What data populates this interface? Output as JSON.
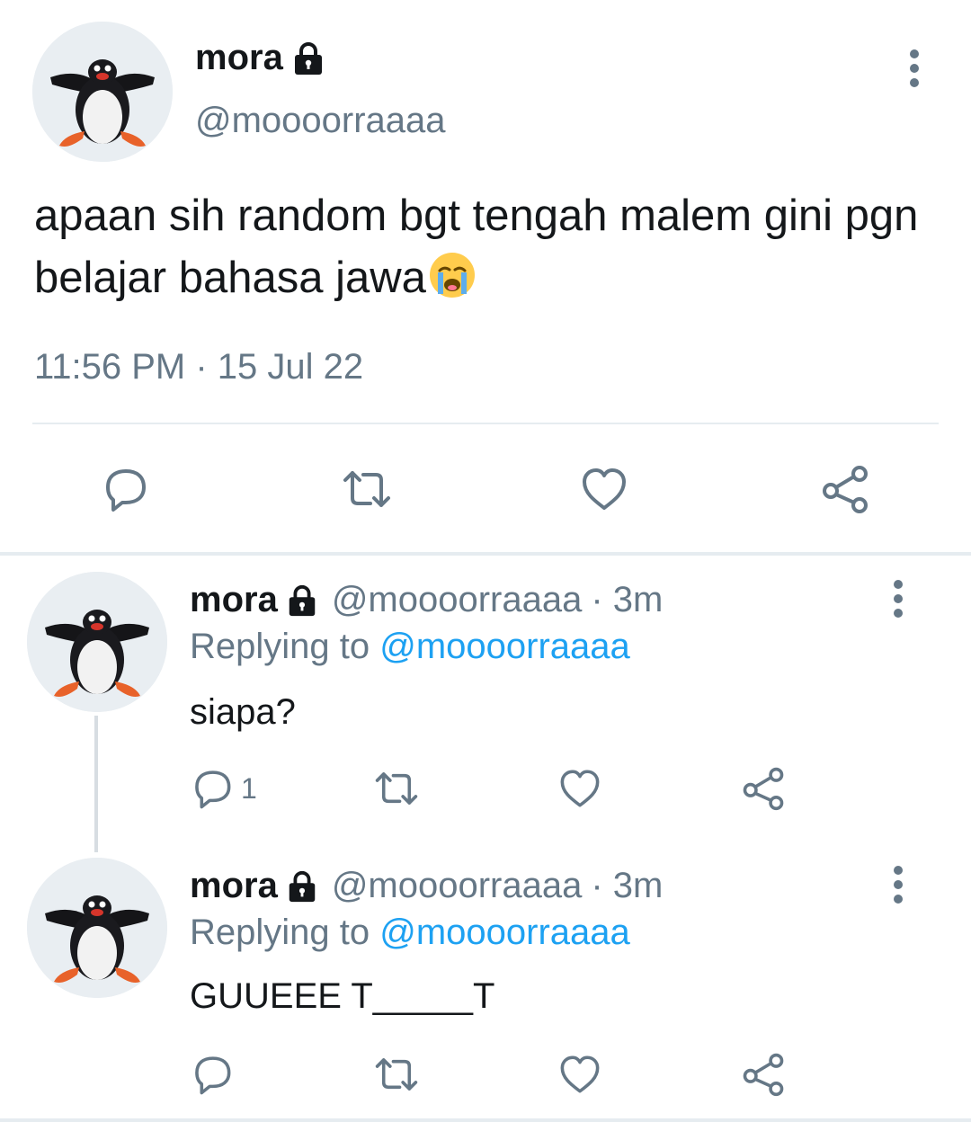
{
  "main_tweet": {
    "name": "mora",
    "handle": "@moooorraaaa",
    "text": "apaan sih random bgt tengah malem gini pgn belajar bahasa jawa",
    "emoji": "loudly-crying-face",
    "timestamp": "11:56 PM · 15 Jul 22",
    "actions": [
      "reply-icon",
      "retweet-icon",
      "like-icon",
      "share-icon"
    ]
  },
  "replies": [
    {
      "name": "mora",
      "handle": "@moooorraaaa",
      "time": "· 3m",
      "replying_prefix": "Replying to",
      "replying_to": "@moooorraaaa",
      "text": "siapa?",
      "reply_count": "1"
    },
    {
      "name": "mora",
      "handle": "@moooorraaaa",
      "time": "· 3m",
      "replying_prefix": "Replying to",
      "replying_to": "@moooorraaaa",
      "text": "GUUEEE T_____T",
      "reply_count": ""
    }
  ],
  "colors": {
    "text": "#14171a",
    "secondary": "#657786",
    "link": "#1da1f2",
    "divider": "#e6ecf0"
  }
}
